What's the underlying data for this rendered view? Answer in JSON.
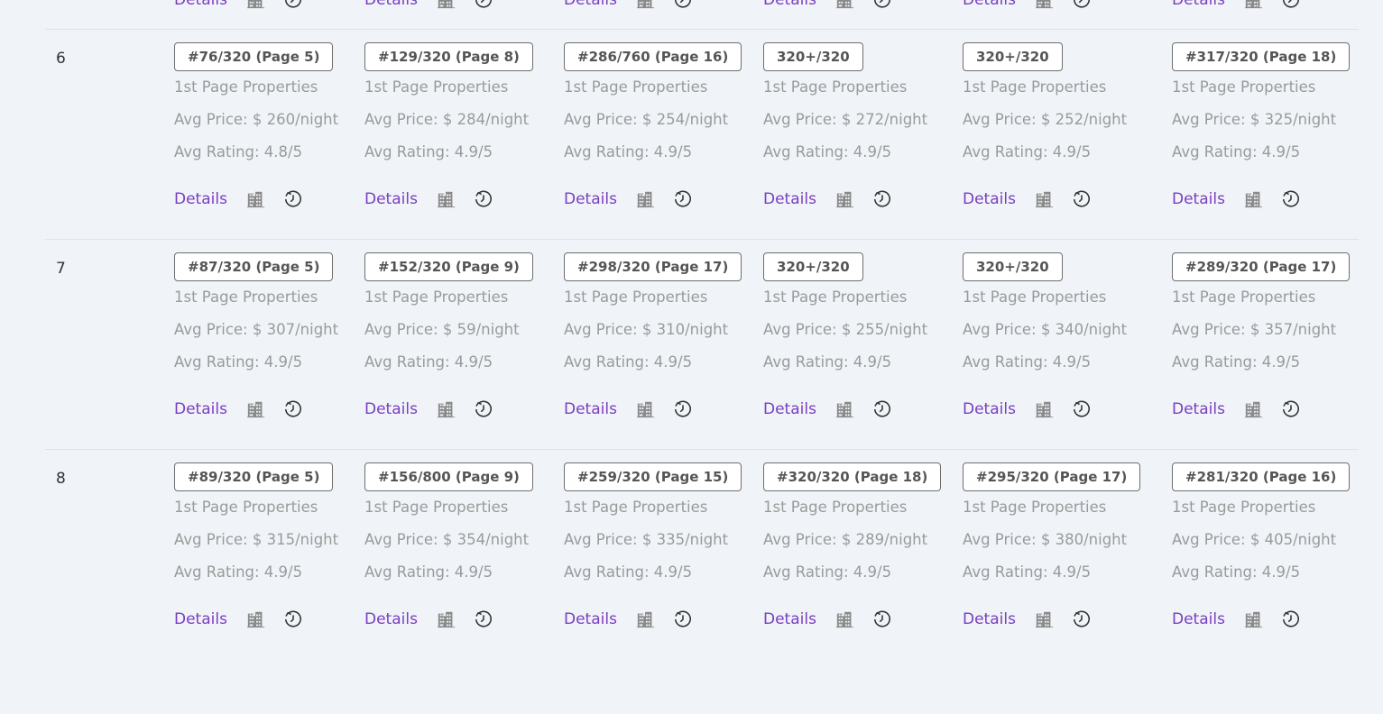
{
  "labels": {
    "page1_props": "1st Page Properties",
    "details": "Details"
  },
  "rows": [
    {
      "num": "6",
      "cells": [
        {
          "rank": "#76/320 (Page 5)",
          "props": "1st Page Properties",
          "price": "Avg Price: $ 260/night",
          "rating": "Avg Rating: 4.8/5"
        },
        {
          "rank": "#129/320 (Page 8)",
          "props": "1st Page Properties",
          "price": "Avg Price: $ 284/night",
          "rating": "Avg Rating: 4.9/5"
        },
        {
          "rank": "#286/760 (Page 16)",
          "props": "1st Page Properties",
          "price": "Avg Price: $ 254/night",
          "rating": "Avg Rating: 4.9/5"
        },
        {
          "rank": "320+/320",
          "props": "1st Page Properties",
          "price": "Avg Price: $ 272/night",
          "rating": "Avg Rating: 4.9/5"
        },
        {
          "rank": "320+/320",
          "props": "1st Page Properties",
          "price": "Avg Price: $ 252/night",
          "rating": "Avg Rating: 4.9/5"
        },
        {
          "rank": "#317/320 (Page 18)",
          "props": "1st Page Properties",
          "price": "Avg Price: $ 325/night",
          "rating": "Avg Rating: 4.9/5"
        }
      ]
    },
    {
      "num": "7",
      "cells": [
        {
          "rank": "#87/320 (Page 5)",
          "props": "1st Page Properties",
          "price": "Avg Price: $ 307/night",
          "rating": "Avg Rating: 4.9/5"
        },
        {
          "rank": "#152/320 (Page 9)",
          "props": "1st Page Properties",
          "price": "Avg Price: $ 59/night",
          "rating": "Avg Rating: 4.9/5"
        },
        {
          "rank": "#298/320 (Page 17)",
          "props": "1st Page Properties",
          "price": "Avg Price: $ 310/night",
          "rating": "Avg Rating: 4.9/5"
        },
        {
          "rank": "320+/320",
          "props": "1st Page Properties",
          "price": "Avg Price: $ 255/night",
          "rating": "Avg Rating: 4.9/5"
        },
        {
          "rank": "320+/320",
          "props": "1st Page Properties",
          "price": "Avg Price: $ 340/night",
          "rating": "Avg Rating: 4.9/5"
        },
        {
          "rank": "#289/320 (Page 17)",
          "props": "1st Page Properties",
          "price": "Avg Price: $ 357/night",
          "rating": "Avg Rating: 4.9/5"
        }
      ]
    },
    {
      "num": "8",
      "cells": [
        {
          "rank": "#89/320 (Page 5)",
          "props": "1st Page Properties",
          "price": "Avg Price: $ 315/night",
          "rating": "Avg Rating: 4.9/5"
        },
        {
          "rank": "#156/800 (Page 9)",
          "props": "1st Page Properties",
          "price": "Avg Price: $ 354/night",
          "rating": "Avg Rating: 4.9/5"
        },
        {
          "rank": "#259/320 (Page 15)",
          "props": "1st Page Properties",
          "price": "Avg Price: $ 335/night",
          "rating": "Avg Rating: 4.9/5"
        },
        {
          "rank": "#320/320 (Page 18)",
          "props": "1st Page Properties",
          "price": "Avg Price: $ 289/night",
          "rating": "Avg Rating: 4.9/5"
        },
        {
          "rank": "#295/320 (Page 17)",
          "props": "1st Page Properties",
          "price": "Avg Price: $ 380/night",
          "rating": "Avg Rating: 4.9/5"
        },
        {
          "rank": "#281/320 (Page 16)",
          "props": "1st Page Properties",
          "price": "Avg Price: $ 405/night",
          "rating": "Avg Rating: 4.9/5"
        }
      ]
    }
  ],
  "colors": {
    "background": "#f0f4f8",
    "link": "#7a3fc0",
    "muted_text": "#9a9a9a",
    "icon": "#8a8a8a"
  },
  "icons": [
    "building-icon",
    "history-clock-icon"
  ]
}
